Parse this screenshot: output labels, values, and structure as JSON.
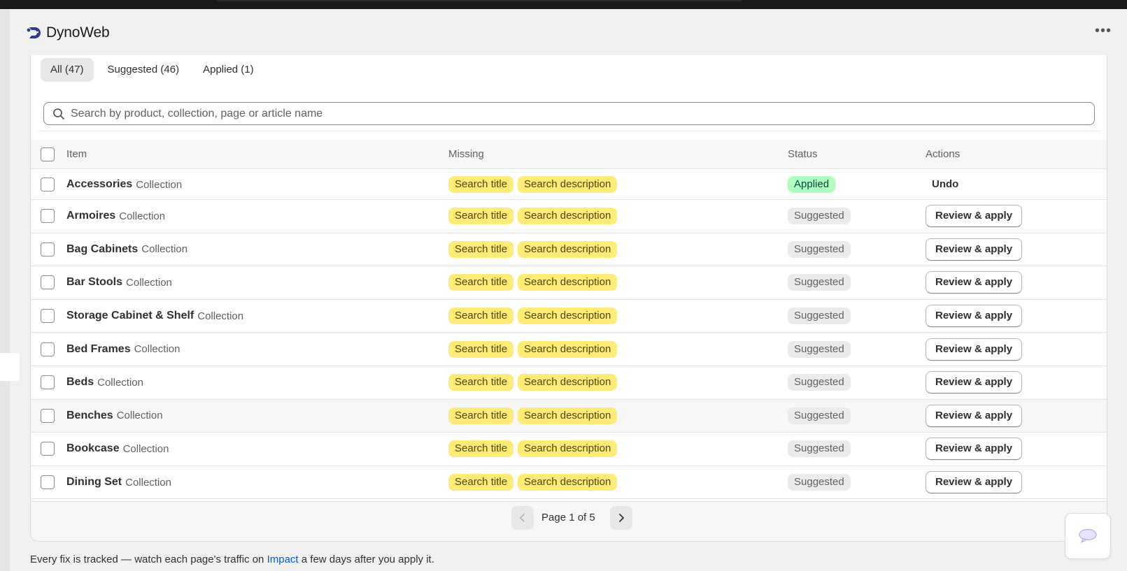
{
  "app": {
    "name": "DynoWeb",
    "logo_icon": "dynoweb-logo-icon",
    "more_icon": "more-horizontal-icon"
  },
  "tabs": [
    {
      "label": "All (47)",
      "active": true
    },
    {
      "label": "Suggested (46)",
      "active": false
    },
    {
      "label": "Applied (1)",
      "active": false
    }
  ],
  "search": {
    "placeholder": "Search by product, collection, page or article name",
    "value": ""
  },
  "table": {
    "headers": {
      "item": "Item",
      "missing": "Missing",
      "status": "Status",
      "actions": "Actions"
    },
    "rows": [
      {
        "name": "Accessories",
        "type": "Collection",
        "missing": [
          "Search title",
          "Search description"
        ],
        "status": "Applied",
        "action": "Undo"
      },
      {
        "name": "Armoires",
        "type": "Collection",
        "missing": [
          "Search title",
          "Search description"
        ],
        "status": "Suggested",
        "action": "Review & apply"
      },
      {
        "name": "Bag Cabinets",
        "type": "Collection",
        "missing": [
          "Search title",
          "Search description"
        ],
        "status": "Suggested",
        "action": "Review & apply"
      },
      {
        "name": "Bar Stools",
        "type": "Collection",
        "missing": [
          "Search title",
          "Search description"
        ],
        "status": "Suggested",
        "action": "Review & apply"
      },
      {
        "name": "Storage Cabinet & Shelf",
        "type": "Collection",
        "missing": [
          "Search title",
          "Search description"
        ],
        "status": "Suggested",
        "action": "Review & apply"
      },
      {
        "name": "Bed Frames",
        "type": "Collection",
        "missing": [
          "Search title",
          "Search description"
        ],
        "status": "Suggested",
        "action": "Review & apply"
      },
      {
        "name": "Beds",
        "type": "Collection",
        "missing": [
          "Search title",
          "Search description"
        ],
        "status": "Suggested",
        "action": "Review & apply"
      },
      {
        "name": "Benches",
        "type": "Collection",
        "missing": [
          "Search title",
          "Search description"
        ],
        "status": "Suggested",
        "action": "Review & apply"
      },
      {
        "name": "Bookcase",
        "type": "Collection",
        "missing": [
          "Search title",
          "Search description"
        ],
        "status": "Suggested",
        "action": "Review & apply"
      },
      {
        "name": "Dining Set",
        "type": "Collection",
        "missing": [
          "Search title",
          "Search description"
        ],
        "status": "Suggested",
        "action": "Review & apply"
      }
    ]
  },
  "pagination": {
    "label": "Page 1 of 5",
    "prev_icon": "chevron-left-icon",
    "next_icon": "chevron-right-icon"
  },
  "footer": {
    "before": "Every fix is tracked — watch each page's traffic on ",
    "link": "Impact",
    "after": " a few days after you apply it."
  },
  "chat": {
    "icon": "chat-bubble-icon"
  },
  "colors": {
    "missing_chip": "#ffeb78",
    "applied_badge": "#affebf",
    "suggested_badge": "#ebebeb",
    "link": "#005bd3"
  }
}
